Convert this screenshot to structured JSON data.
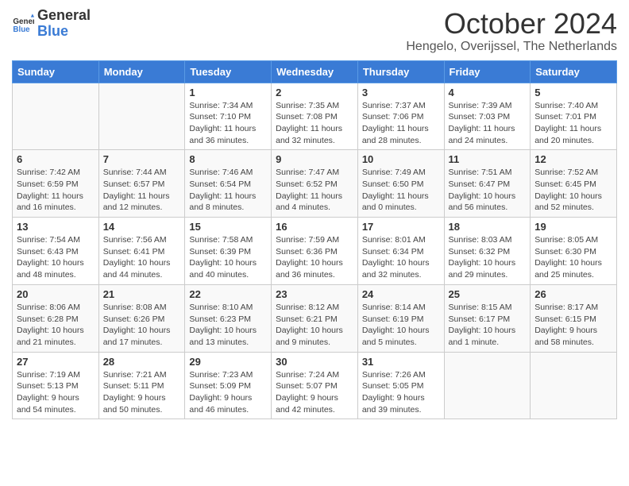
{
  "header": {
    "logo_general": "General",
    "logo_blue": "Blue",
    "month_title": "October 2024",
    "location": "Hengelo, Overijssel, The Netherlands"
  },
  "weekdays": [
    "Sunday",
    "Monday",
    "Tuesday",
    "Wednesday",
    "Thursday",
    "Friday",
    "Saturday"
  ],
  "weeks": [
    [
      {
        "day": "",
        "info": ""
      },
      {
        "day": "",
        "info": ""
      },
      {
        "day": "1",
        "info": "Sunrise: 7:34 AM\nSunset: 7:10 PM\nDaylight: 11 hours and 36 minutes."
      },
      {
        "day": "2",
        "info": "Sunrise: 7:35 AM\nSunset: 7:08 PM\nDaylight: 11 hours and 32 minutes."
      },
      {
        "day": "3",
        "info": "Sunrise: 7:37 AM\nSunset: 7:06 PM\nDaylight: 11 hours and 28 minutes."
      },
      {
        "day": "4",
        "info": "Sunrise: 7:39 AM\nSunset: 7:03 PM\nDaylight: 11 hours and 24 minutes."
      },
      {
        "day": "5",
        "info": "Sunrise: 7:40 AM\nSunset: 7:01 PM\nDaylight: 11 hours and 20 minutes."
      }
    ],
    [
      {
        "day": "6",
        "info": "Sunrise: 7:42 AM\nSunset: 6:59 PM\nDaylight: 11 hours and 16 minutes."
      },
      {
        "day": "7",
        "info": "Sunrise: 7:44 AM\nSunset: 6:57 PM\nDaylight: 11 hours and 12 minutes."
      },
      {
        "day": "8",
        "info": "Sunrise: 7:46 AM\nSunset: 6:54 PM\nDaylight: 11 hours and 8 minutes."
      },
      {
        "day": "9",
        "info": "Sunrise: 7:47 AM\nSunset: 6:52 PM\nDaylight: 11 hours and 4 minutes."
      },
      {
        "day": "10",
        "info": "Sunrise: 7:49 AM\nSunset: 6:50 PM\nDaylight: 11 hours and 0 minutes."
      },
      {
        "day": "11",
        "info": "Sunrise: 7:51 AM\nSunset: 6:47 PM\nDaylight: 10 hours and 56 minutes."
      },
      {
        "day": "12",
        "info": "Sunrise: 7:52 AM\nSunset: 6:45 PM\nDaylight: 10 hours and 52 minutes."
      }
    ],
    [
      {
        "day": "13",
        "info": "Sunrise: 7:54 AM\nSunset: 6:43 PM\nDaylight: 10 hours and 48 minutes."
      },
      {
        "day": "14",
        "info": "Sunrise: 7:56 AM\nSunset: 6:41 PM\nDaylight: 10 hours and 44 minutes."
      },
      {
        "day": "15",
        "info": "Sunrise: 7:58 AM\nSunset: 6:39 PM\nDaylight: 10 hours and 40 minutes."
      },
      {
        "day": "16",
        "info": "Sunrise: 7:59 AM\nSunset: 6:36 PM\nDaylight: 10 hours and 36 minutes."
      },
      {
        "day": "17",
        "info": "Sunrise: 8:01 AM\nSunset: 6:34 PM\nDaylight: 10 hours and 32 minutes."
      },
      {
        "day": "18",
        "info": "Sunrise: 8:03 AM\nSunset: 6:32 PM\nDaylight: 10 hours and 29 minutes."
      },
      {
        "day": "19",
        "info": "Sunrise: 8:05 AM\nSunset: 6:30 PM\nDaylight: 10 hours and 25 minutes."
      }
    ],
    [
      {
        "day": "20",
        "info": "Sunrise: 8:06 AM\nSunset: 6:28 PM\nDaylight: 10 hours and 21 minutes."
      },
      {
        "day": "21",
        "info": "Sunrise: 8:08 AM\nSunset: 6:26 PM\nDaylight: 10 hours and 17 minutes."
      },
      {
        "day": "22",
        "info": "Sunrise: 8:10 AM\nSunset: 6:23 PM\nDaylight: 10 hours and 13 minutes."
      },
      {
        "day": "23",
        "info": "Sunrise: 8:12 AM\nSunset: 6:21 PM\nDaylight: 10 hours and 9 minutes."
      },
      {
        "day": "24",
        "info": "Sunrise: 8:14 AM\nSunset: 6:19 PM\nDaylight: 10 hours and 5 minutes."
      },
      {
        "day": "25",
        "info": "Sunrise: 8:15 AM\nSunset: 6:17 PM\nDaylight: 10 hours and 1 minute."
      },
      {
        "day": "26",
        "info": "Sunrise: 8:17 AM\nSunset: 6:15 PM\nDaylight: 9 hours and 58 minutes."
      }
    ],
    [
      {
        "day": "27",
        "info": "Sunrise: 7:19 AM\nSunset: 5:13 PM\nDaylight: 9 hours and 54 minutes."
      },
      {
        "day": "28",
        "info": "Sunrise: 7:21 AM\nSunset: 5:11 PM\nDaylight: 9 hours and 50 minutes."
      },
      {
        "day": "29",
        "info": "Sunrise: 7:23 AM\nSunset: 5:09 PM\nDaylight: 9 hours and 46 minutes."
      },
      {
        "day": "30",
        "info": "Sunrise: 7:24 AM\nSunset: 5:07 PM\nDaylight: 9 hours and 42 minutes."
      },
      {
        "day": "31",
        "info": "Sunrise: 7:26 AM\nSunset: 5:05 PM\nDaylight: 9 hours and 39 minutes."
      },
      {
        "day": "",
        "info": ""
      },
      {
        "day": "",
        "info": ""
      }
    ]
  ]
}
